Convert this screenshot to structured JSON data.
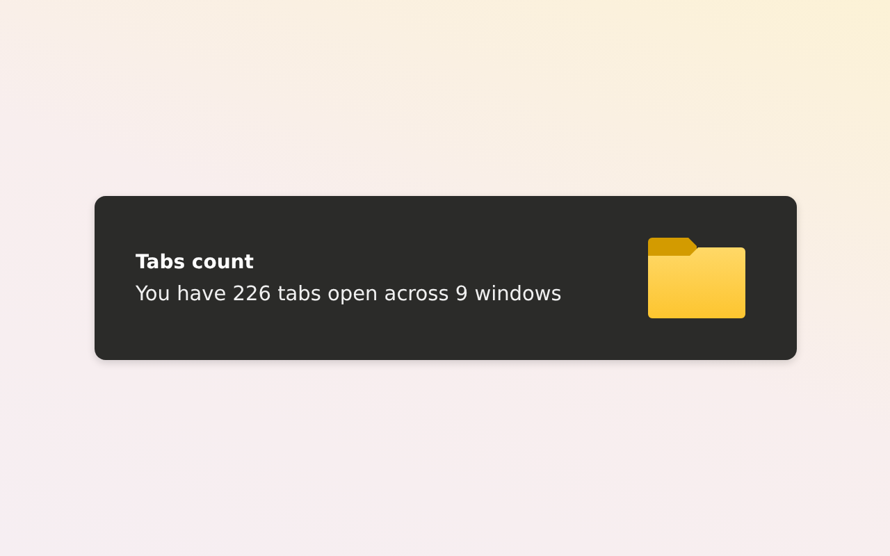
{
  "card": {
    "title": "Tabs count",
    "message": "You have 226 tabs open across 9 windows"
  }
}
